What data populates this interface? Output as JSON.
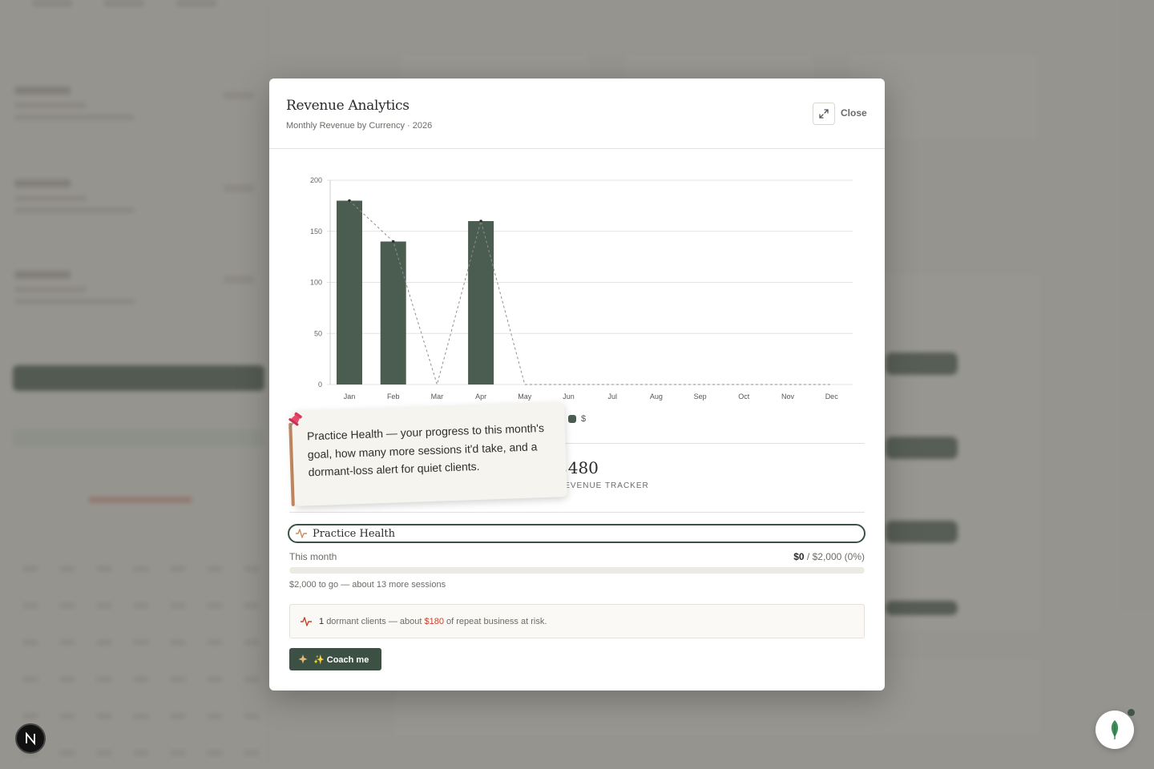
{
  "modal": {
    "title": "Revenue Analytics",
    "subtitle": "Monthly Revenue by Currency · 2026",
    "close_label": "Close"
  },
  "chart_data": {
    "type": "bar",
    "categories": [
      "Jan",
      "Feb",
      "Mar",
      "Apr",
      "May",
      "Jun",
      "Jul",
      "Aug",
      "Sep",
      "Oct",
      "Nov",
      "Dec"
    ],
    "series": [
      {
        "name": "$",
        "values": [
          180,
          140,
          0,
          160,
          0,
          0,
          0,
          0,
          0,
          0,
          0,
          0
        ],
        "color": "#4a5d50"
      }
    ],
    "overlay_line": {
      "style": "dashed",
      "values": [
        180,
        140,
        0,
        160,
        0,
        0,
        0,
        0,
        0,
        0,
        0,
        0
      ]
    },
    "yticks": [
      0,
      50,
      100,
      150,
      200
    ],
    "ylim": [
      0,
      200
    ],
    "grid": true,
    "legend_position": "bottom"
  },
  "revenue": {
    "amount": "$480",
    "label": "REVENUE TRACKER"
  },
  "practice_health": {
    "title": "Practice Health",
    "month_label": "This month",
    "current": "$0",
    "goal": "$2,000",
    "percent_text": "(0%)",
    "progress_fraction": 0,
    "to_go_text": "$2,000 to go — about 13 more sessions",
    "alert": {
      "count": "1",
      "text_a": "dormant clients — about",
      "amount": "$180",
      "text_b": "of repeat business at risk."
    },
    "coach_label": "✨ Coach me"
  },
  "tooltip": {
    "text": "Practice Health — your progress to this month's goal, how many more sessions it'd take, and a dormant-loss alert for quiet clients."
  },
  "colors": {
    "accent": "#3d5044",
    "bar": "#4a5d50",
    "alert_red": "#c3432d",
    "pole": "#c98d62"
  },
  "icons": {
    "expand": "expand-icon",
    "pulse": "pulse-icon",
    "sparkle": "sparkle-icon",
    "pin": "pushpin-icon",
    "leaf": "leaf-icon"
  }
}
